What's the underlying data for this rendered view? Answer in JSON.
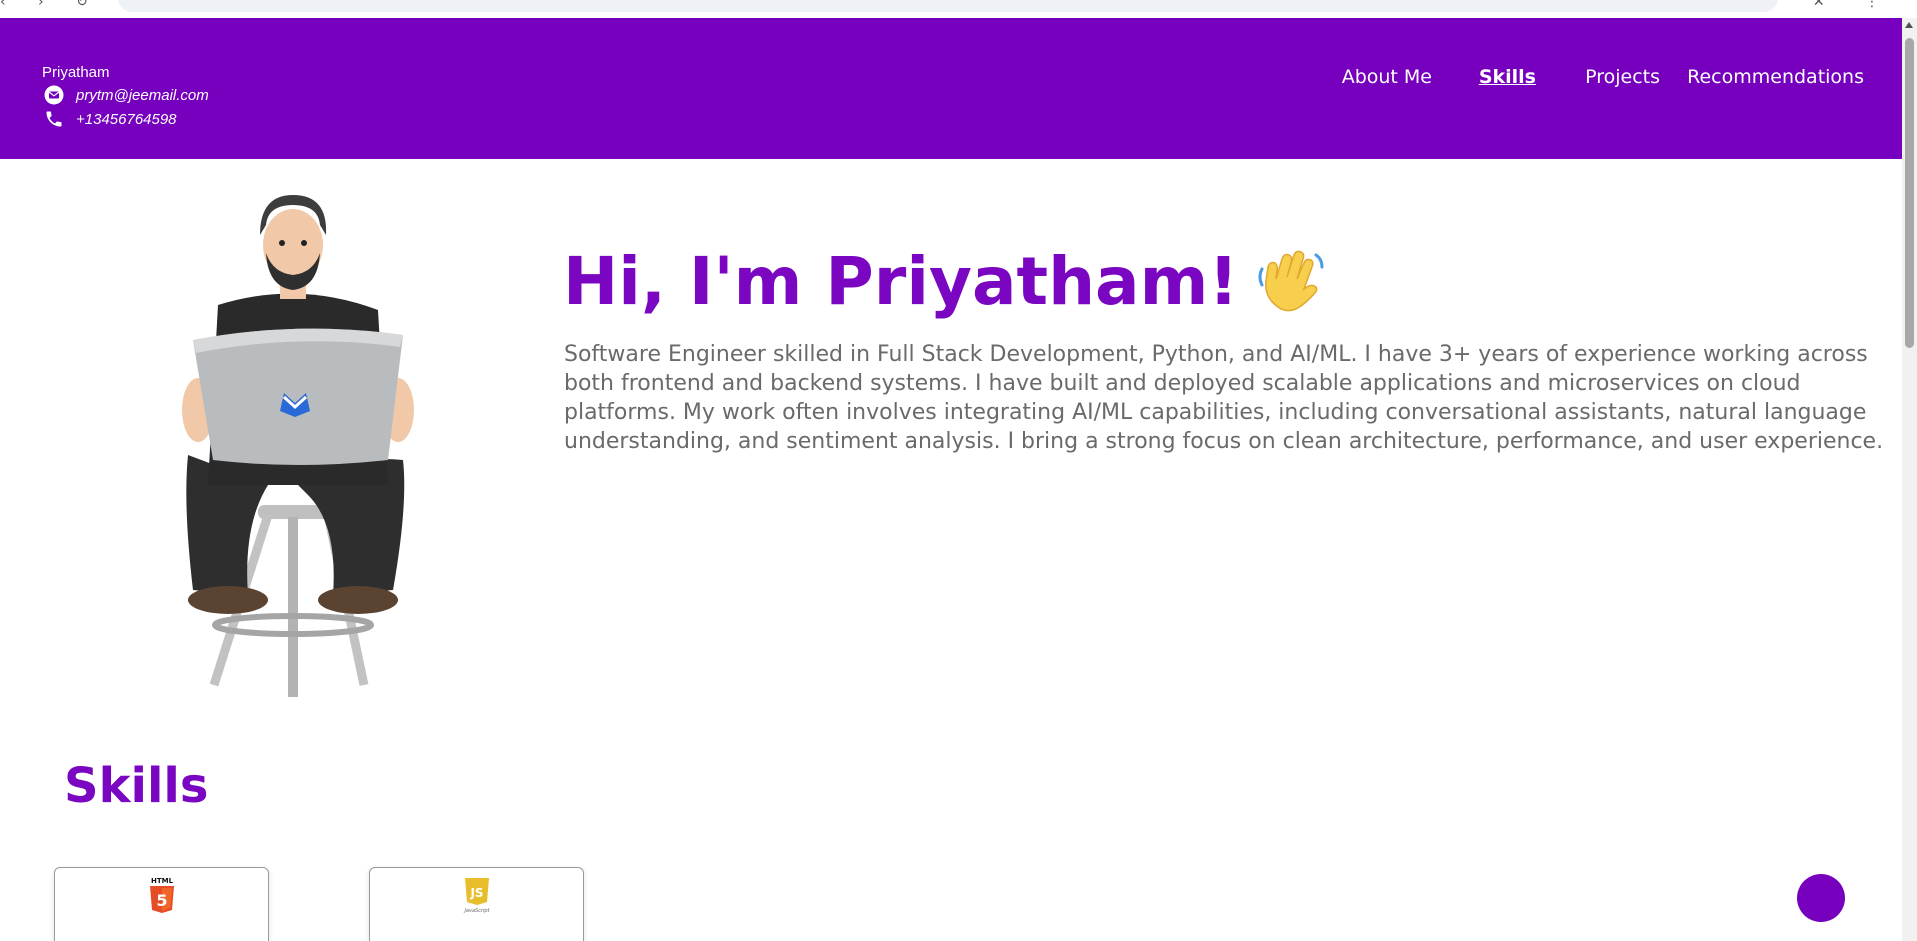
{
  "header": {
    "brand_name": "Priyatham",
    "email": "prytm@jeemail.com",
    "phone": "+13456764598",
    "background": "#7600be"
  },
  "nav": {
    "items": [
      {
        "label": "About Me",
        "active": false
      },
      {
        "label": "Skills",
        "active": true
      },
      {
        "label": "Projects",
        "active": false
      },
      {
        "label": "Recommendations",
        "active": false
      }
    ]
  },
  "hero": {
    "title": "Hi, I'm Priyatham!",
    "title_icon": "waving-hand-icon",
    "description": "Software Engineer skilled in Full Stack Development, Python, and AI/ML. I have 3+ years of experience working across both frontend and backend systems. I have built and deployed scalable applications and microservices on cloud platforms. My work often involves integrating AI/ML capabilities, including conversational assistants, natural language understanding, and sentiment analysis. I bring a strong focus on clean architecture, performance, and user experience.",
    "accent": "#7a06c2"
  },
  "skills": {
    "heading": "Skills",
    "cards": [
      {
        "icon": "html5-icon",
        "badge_text": "HTML",
        "badge_number": "5"
      },
      {
        "icon": "javascript-icon",
        "badge_text": "JS",
        "caption": "JavaScript"
      }
    ]
  },
  "fab": {
    "icon": "chat-icon"
  }
}
